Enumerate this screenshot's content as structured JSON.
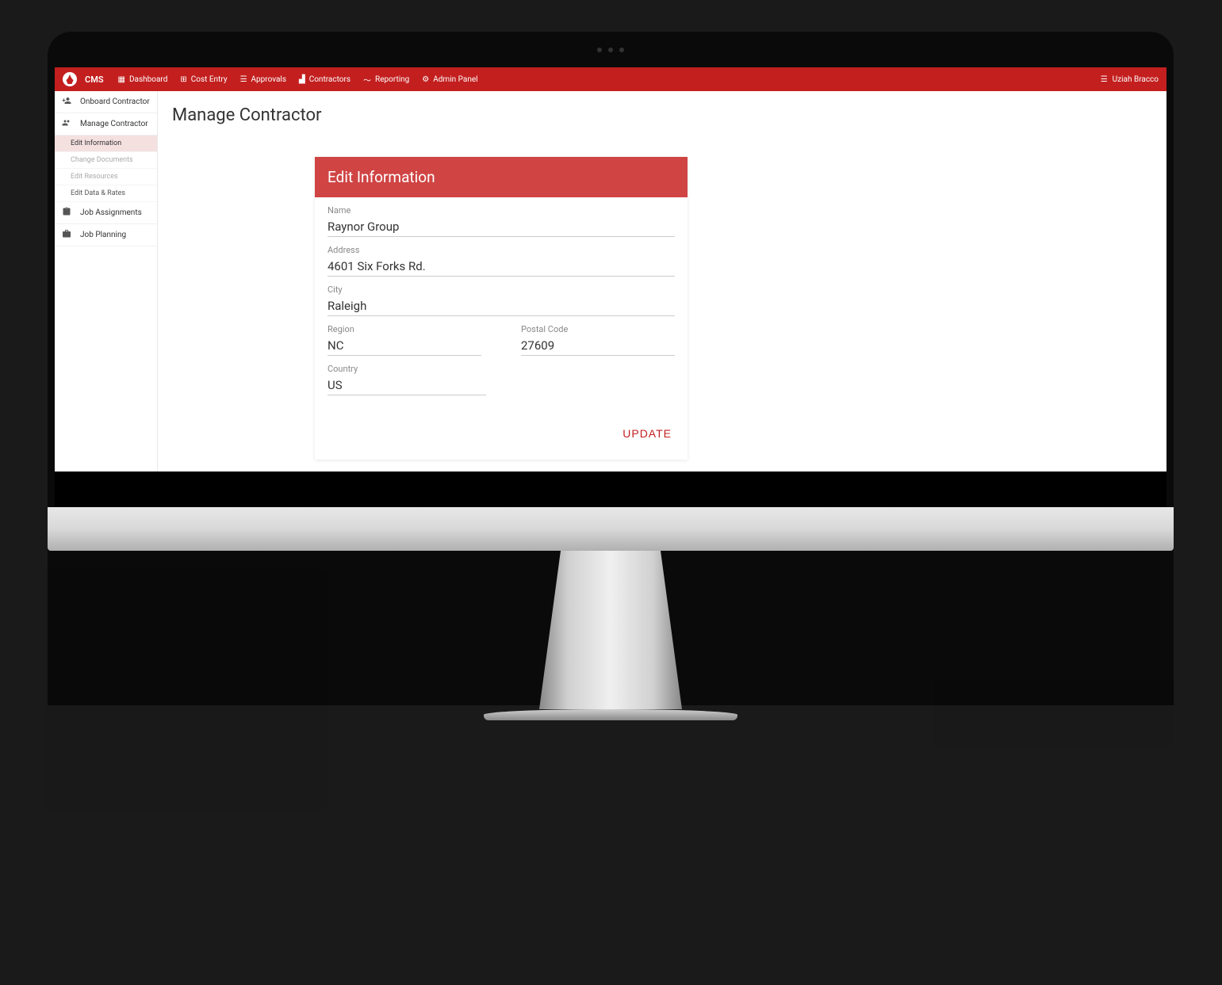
{
  "app": {
    "name": "CMS",
    "user": "Uziah Bracco"
  },
  "nav": [
    {
      "label": "Dashboard",
      "icon": "dashboard"
    },
    {
      "label": "Cost Entry",
      "icon": "attach-money"
    },
    {
      "label": "Approvals",
      "icon": "check"
    },
    {
      "label": "Contractors",
      "icon": "people"
    },
    {
      "label": "Reporting",
      "icon": "trending"
    },
    {
      "label": "Admin Panel",
      "icon": "lock"
    }
  ],
  "sidebar": {
    "items": [
      {
        "label": "Onboard Contractor",
        "icon": "person-add"
      },
      {
        "label": "Manage Contractor",
        "icon": "people",
        "active": true,
        "subitems": [
          {
            "label": "Edit Information",
            "selected": true
          },
          {
            "label": "Change Documents"
          },
          {
            "label": "Edit Resources"
          },
          {
            "label": "Edit Data & Rates"
          }
        ]
      },
      {
        "label": "Job Assignments",
        "icon": "assignment"
      },
      {
        "label": "Job Planning",
        "icon": "work"
      }
    ]
  },
  "page": {
    "title": "Manage Contractor",
    "card_header": "Edit Information",
    "fields": {
      "name": {
        "label": "Name",
        "value": "Raynor Group"
      },
      "address": {
        "label": "Address",
        "value": "4601 Six Forks Rd."
      },
      "city": {
        "label": "City",
        "value": "Raleigh"
      },
      "region": {
        "label": "Region",
        "value": "NC"
      },
      "postal": {
        "label": "Postal Code",
        "value": "27609"
      },
      "country": {
        "label": "Country",
        "value": "US"
      }
    },
    "update_button": "UPDATE"
  },
  "status_url": "https://cms-40hs.prometheusgroup.dev/Contractors/Manage/Information"
}
